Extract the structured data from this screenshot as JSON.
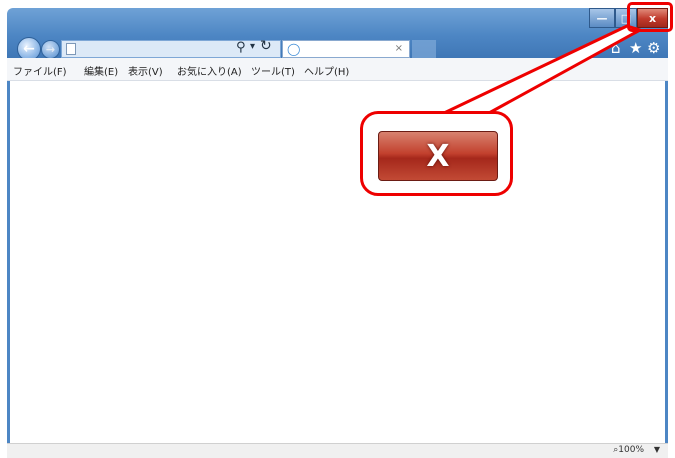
{
  "menu": {
    "file": "ファイル(F)",
    "edit": "編集(E)",
    "view": "表示(V)",
    "favorites": "お気に入り(A)",
    "tools": "ツール(T)",
    "help": "ヘルプ(H)"
  },
  "tab": {
    "close_glyph": "×"
  },
  "window_controls": {
    "close_glyph": "x"
  },
  "callout": {
    "close_label": "X"
  },
  "status": {
    "zoom": "100%",
    "zoom_arrow": "▼"
  },
  "colors": {
    "callout_outline": "#e00000",
    "close_red": "#c0392b",
    "frame_blue": "#4d86c4"
  },
  "icons": [
    "back-icon",
    "forward-icon",
    "search-icon",
    "refresh-icon",
    "ie-icon",
    "home-icon",
    "favorites-star-icon",
    "settings-gear-icon",
    "zoom-icon"
  ]
}
